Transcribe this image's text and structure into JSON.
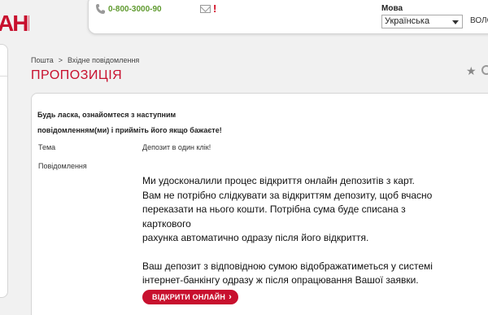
{
  "logo": {
    "text": "АНК"
  },
  "header": {
    "phone": "0-800-3000-90",
    "alert_mark": "!",
    "language_label": "Мова",
    "language_selected": "Українська",
    "cut_off_right": "ВОЛО"
  },
  "breadcrumb": {
    "root": "Пошта",
    "separator": ">",
    "current": "Вхідне повідомлення"
  },
  "page_title": "ПРОПОЗИЦІЯ",
  "notice": {
    "line1": "Будь ласка, ознайомтеся з наступним",
    "line2": "повідомленням(ми) і прийміть його якщо бажаєте!"
  },
  "fields": {
    "subject_label": "Тема",
    "subject_value": "Депозит в один клік!",
    "message_label": "Повідомлення"
  },
  "message": {
    "p1_l1": "Ми удосконалили  процес відкриття онлайн депозитів з карт.",
    "p1_l2": "Вам не потрібно слідкувати за відкриттям депозиту, щоб вчасно",
    "p1_l3": "переказати на нього кошти. Потрібна сума буде списана з карткового",
    "p1_l4": "рахунка автоматично одразу після його відкриття.",
    "p2_l1": "Ваш депозит з відповідною сумою відображатиметься у системі",
    "p2_l2": "інтернет-банкінгу одразу ж після опрацювання Вашої заявки."
  },
  "cta": {
    "label": "ВІДКРИТИ ОНЛАЙН",
    "chevron": "›"
  },
  "colors": {
    "accent": "#c8102e",
    "phone_green": "#5f9a2f"
  },
  "icons": {
    "star": "★",
    "phone": "phone-icon",
    "mail": "mail-icon",
    "search": "search-icon"
  }
}
